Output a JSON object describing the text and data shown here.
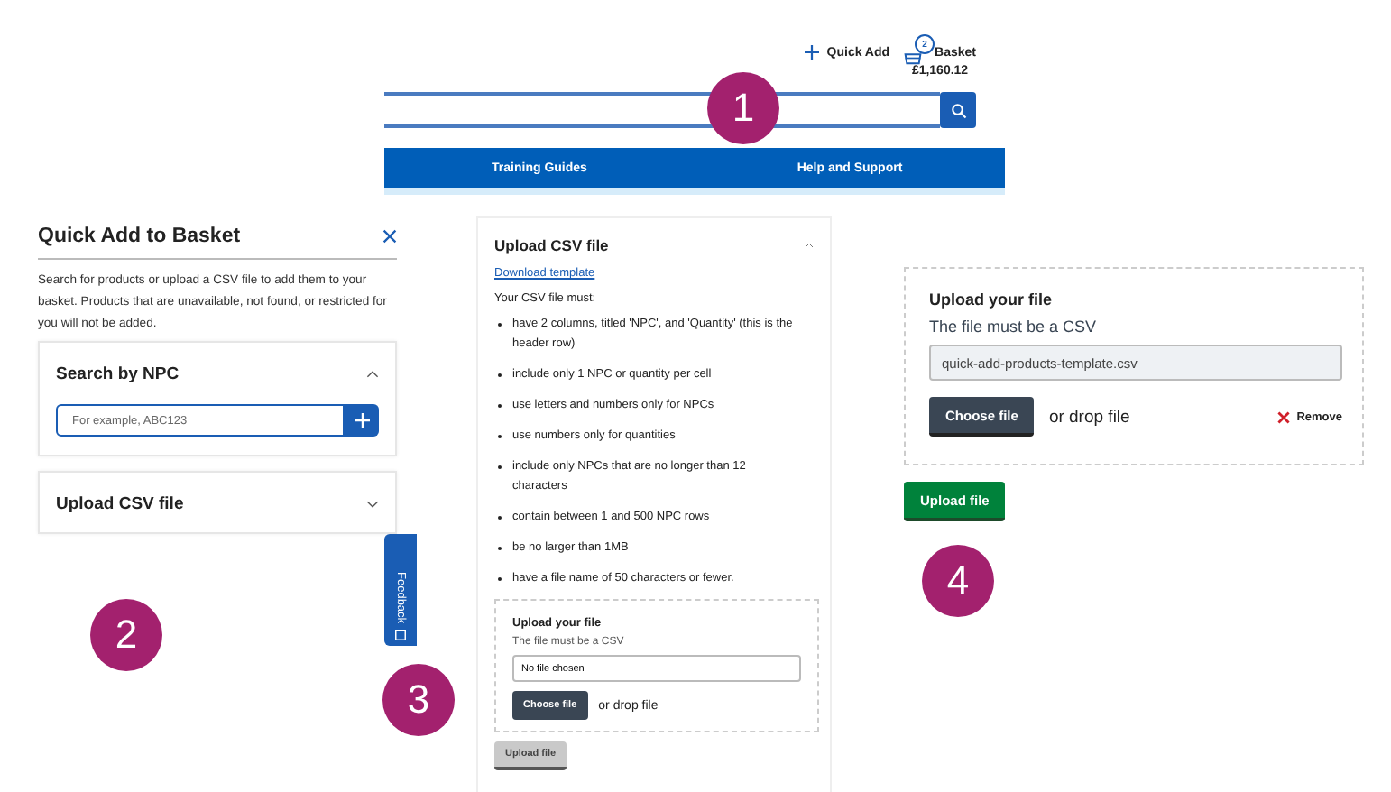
{
  "header": {
    "quick_add": "Quick Add",
    "basket": {
      "label": "Basket",
      "count": "2",
      "total": "£1,160.12"
    },
    "nav": [
      "Training Guides",
      "Help and Support"
    ]
  },
  "quick_add_panel": {
    "title": "Quick Add to Basket",
    "description": "Search for products or upload a CSV file to add them to your basket. Products that are unavailable, not found, or restricted for you will not be added.",
    "sections": [
      {
        "title": "Search by NPC",
        "expanded": true,
        "placeholder": "For example, ABC123"
      },
      {
        "title": "Upload CSV file",
        "expanded": false
      }
    ]
  },
  "feedback_tab": "Feedback",
  "csv_panel": {
    "title": "Upload CSV file",
    "expanded": true,
    "link": "Download template",
    "intro": "Your CSV file must:",
    "rules": [
      "have 2 columns, titled 'NPC', and 'Quantity' (this is the header row)",
      "include only 1 NPC or quantity per cell",
      "use letters and numbers only for NPCs",
      "use numbers only for quantities",
      "include only NPCs that are no longer than 12 characters",
      "contain between 1 and 500 NPC rows",
      "be no larger than 1MB",
      "have a file name of 50 characters or fewer."
    ],
    "upload": {
      "title": "Upload your file",
      "hint": "The file must be a CSV",
      "value": "No file chosen",
      "choose": "Choose file",
      "drop": "or drop file"
    },
    "submit": {
      "label": "Upload file",
      "disabled": true
    }
  },
  "file_panel": {
    "upload": {
      "title": "Upload your file",
      "hint": "The file must be a CSV",
      "value": "quick-add-products-template.csv",
      "choose": "Choose file",
      "drop": "or drop file",
      "remove": "Remove"
    },
    "submit": {
      "label": "Upload file",
      "disabled": false
    }
  },
  "callouts": [
    "1",
    "2",
    "3",
    "4"
  ]
}
